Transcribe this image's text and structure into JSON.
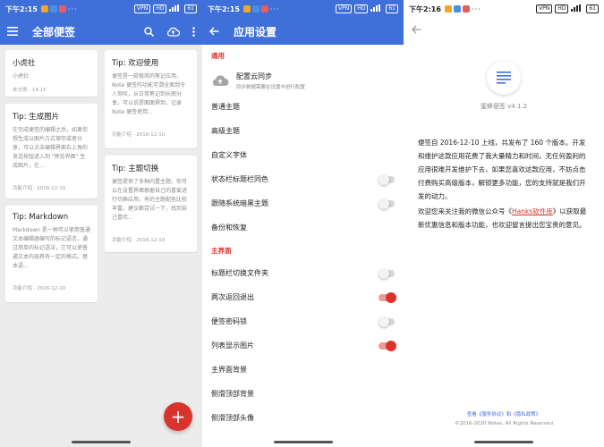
{
  "status": {
    "time_left": "下午2:15",
    "time_middle": "下午2:15",
    "time_right": "下午2:16",
    "badges": [
      "VPN",
      "HD"
    ],
    "battery": "61",
    "more": "···"
  },
  "notes_screen": {
    "title": "全部便签",
    "icons": [
      "menu-icon",
      "search-icon",
      "cloud-sync-icon",
      "more-vert-icon"
    ],
    "left_column": [
      {
        "title": "小虎社",
        "body": "小虎社",
        "meta": "未分类 · 14:15"
      },
      {
        "title": "Tip: 生成图片",
        "body": "在完成便签的编辑之后，如果你想生成以图片方式保存或者分享，可以点击编辑界面右上角的发送按钮进入到 \"预览界面\" 生成图片，在...",
        "meta": "功能介绍 · 2016-12-10"
      },
      {
        "title": "Tip: Markdown",
        "body": "Markdown 是一种可以使用普通文本编辑器编写的标记语言，通过简单的标记语法，它可以使普通文本内容具有一定的格式。基本语...",
        "meta": "功能介绍 · 2016-12-10"
      }
    ],
    "right_column": [
      {
        "title": "Tip: 欢迎使用",
        "body": "便签是一款极简的笔记应用，Note 便签的功能可谓全面到令人惊叹，从日常笔记到长图分享，可以说是面面俱到，记录Note 便签使用...",
        "meta": "功能介绍 · 2016-12-10"
      },
      {
        "title": "Tip: 主题切换",
        "body": "便签提供了多种内置主题，你可以在设置界面根据自己的喜爱进行切换应用，有的主题配色比较丰富，建议都尝试一下，找到自己喜欢...",
        "meta": "功能介绍 · 2016-12-10"
      }
    ],
    "fab_label": "+"
  },
  "settings_screen": {
    "title": "应用设置",
    "section_general": "通用",
    "cloud": {
      "label": "配置云同步",
      "sub": "同步数据需要在设置中进行配置"
    },
    "general_rows": [
      {
        "label": "普通主题",
        "toggle": null
      },
      {
        "label": "高级主题",
        "toggle": null
      },
      {
        "label": "自定义字体",
        "toggle": null
      },
      {
        "label": "状态栏标题栏同色",
        "toggle": false
      },
      {
        "label": "跟随系统暗黑主题",
        "toggle": false
      },
      {
        "label": "备份和恢复",
        "toggle": null
      }
    ],
    "section_main": "主界面",
    "main_rows": [
      {
        "label": "标题栏切换文件夹",
        "toggle": false
      },
      {
        "label": "两次返回退出",
        "toggle": true
      },
      {
        "label": "便签密码锁",
        "toggle": false
      },
      {
        "label": "列表显示图片",
        "toggle": true
      },
      {
        "label": "主界面背景",
        "toggle": null
      },
      {
        "label": "侧滑顶部背景",
        "toggle": null
      },
      {
        "label": "侧滑顶部头像",
        "toggle": null
      }
    ]
  },
  "about_screen": {
    "version": "蜜蜂便签 v4.1.2",
    "para1": "便签自 2016-12-10 上线，共发布了 160 个版本。开发和维护这款应用花费了我大量精力和时间，无任何盈利的应用很难开发维护下去，如果您喜欢这款应用，不妨点击付费购买高级版本，解锁更多功能，您的支持就是我们开发的动力。",
    "para2_before": "欢迎您来关注我的微信公众号《",
    "para2_link": "Hanks软件库",
    "para2_after": "》以获取最新优惠信息和版本功能，也欢迎留言提出您宝贵的意见。",
    "footer_prefix": "查看",
    "footer_link1": "《服务协议》",
    "footer_and": "和",
    "footer_link2": "《隐私政策》",
    "copyright": "©2016-2020 Notes. All Rights Reserved"
  },
  "colors": {
    "primary": "#3f6fd8",
    "accent": "#d9342b"
  }
}
